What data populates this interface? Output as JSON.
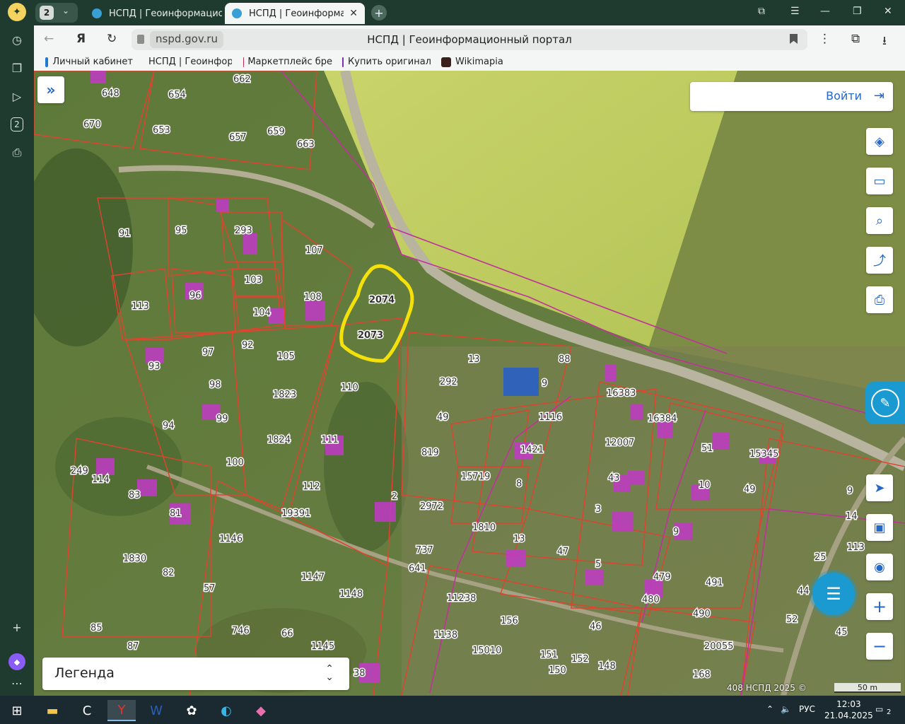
{
  "browser": {
    "tab_group_count": "2",
    "tabs": [
      {
        "title": "НСПД | Геоинформацион",
        "active": false
      },
      {
        "title": "НСПД | Геоинформаци",
        "active": true
      }
    ],
    "new_tab": "+",
    "address": {
      "host": "nspd.gov.ru",
      "page_title": "НСПД | Геоинформационный портал"
    },
    "bookmarks": [
      {
        "label": "Личный кабинет",
        "icon": "gosuslugi-icon",
        "color": "#1f78d1"
      },
      {
        "label": "НСПД | Геоинфор",
        "icon": "nspd-icon",
        "color": "#39a0d6"
      },
      {
        "label": "Маркетплейс бре",
        "icon": "marketplace-icon",
        "color": "#c0264a"
      },
      {
        "label": "Купить оригинал",
        "icon": "shop-icon",
        "color": "#7a2fb8"
      },
      {
        "label": "Wikimapia",
        "icon": "wikimapia-icon",
        "color": "#3a1f1a"
      }
    ]
  },
  "sidebar": {
    "tab_count": "2"
  },
  "map": {
    "expand_icon": "»",
    "login_label": "Войти",
    "legend_label": "Легенда",
    "footer": "408  НСПД 2025 ©",
    "scale_label": "50 m",
    "tools": [
      "layers-icon",
      "ruler-icon",
      "area-search-icon",
      "share-icon",
      "print-icon",
      "locate-icon",
      "picture-in-picture-icon",
      "geo-pin-icon",
      "zoom-in-icon",
      "zoom-out-icon"
    ],
    "highlight_labels": [
      "2074",
      "2073"
    ],
    "parcel_labels": [
      "648",
      "662",
      "654",
      "670",
      "653",
      "657",
      "659",
      "663",
      "91",
      "95",
      "293",
      "107",
      "103",
      "96",
      "113",
      "108",
      "104",
      "2074",
      "2073",
      "97",
      "92",
      "93",
      "105",
      "98",
      "1823",
      "110",
      "99",
      "94",
      "1824",
      "111",
      "100",
      "249",
      "114",
      "83",
      "81",
      "112",
      "19391",
      "1146",
      "1830",
      "82",
      "57",
      "1147",
      "1148",
      "85",
      "746",
      "66",
      "87",
      "1145",
      "13",
      "88",
      "9",
      "292",
      "16383",
      "49",
      "1116",
      "16384",
      "819",
      "1421",
      "12007",
      "51",
      "15345",
      "15719",
      "8",
      "43",
      "10",
      "49",
      "2",
      "2972",
      "1810",
      "3",
      "9",
      "14",
      "737",
      "13",
      "47",
      "5",
      "25",
      "641",
      "479",
      "491",
      "11238",
      "480",
      "44",
      "156",
      "46",
      "490",
      "1138",
      "52",
      "151",
      "15010",
      "152",
      "148",
      "20055",
      "45",
      "150",
      "168",
      "38",
      "113",
      "9"
    ]
  },
  "taskbar": {
    "lang": "РУС",
    "time": "12:03",
    "date": "21.04.2025",
    "notifications": "2"
  }
}
